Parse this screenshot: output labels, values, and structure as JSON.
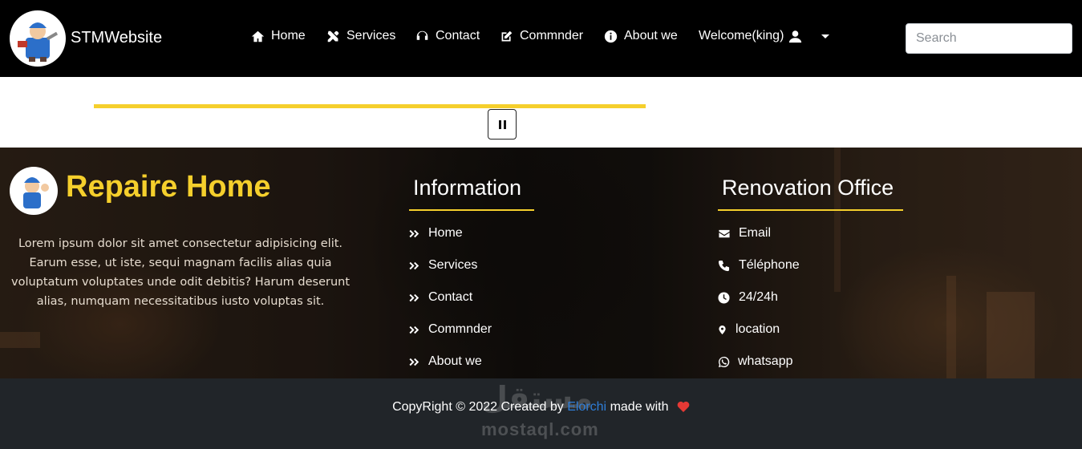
{
  "navbar": {
    "brand": "STMWebsite",
    "items": [
      {
        "label": "Home",
        "icon": "home-icon"
      },
      {
        "label": "Services",
        "icon": "tools-icon"
      },
      {
        "label": "Contact",
        "icon": "headset-icon"
      },
      {
        "label": "Commnder",
        "icon": "edit-icon"
      },
      {
        "label": "About we",
        "icon": "info-icon"
      }
    ],
    "user_menu": {
      "label": "Welcome(king)",
      "icon": "user-icon"
    },
    "search": {
      "placeholder": "Search",
      "value": ""
    }
  },
  "slider": {
    "progress_fraction": 0.512,
    "control": "pause-icon",
    "accent_color": "#f5cf2c"
  },
  "footer": {
    "brand": "Repaire Home",
    "description": "Lorem ipsum dolor sit amet consectetur adipisicing elit. Earum esse, ut iste, sequi magnam facilis alias quia voluptatum voluptates unde odit debitis? Harum deserunt alias, numquam necessitatibus iusto voluptas sit.",
    "information": {
      "title": "Information",
      "links": [
        "Home",
        "Services",
        "Contact",
        "Commnder",
        "About we"
      ]
    },
    "office": {
      "title": "Renovation Office",
      "items": [
        {
          "label": "Email",
          "icon": "envelope-icon"
        },
        {
          "label": "Téléphone",
          "icon": "phone-icon"
        },
        {
          "label": "24/24h",
          "icon": "clock-icon"
        },
        {
          "label": "location",
          "icon": "map-marker-icon"
        },
        {
          "label": "whatsapp",
          "icon": "whatsapp-icon"
        }
      ]
    }
  },
  "copyright": {
    "prefix": "CopyRight © 2022 Created by",
    "author": "Elorchi",
    "suffix": "made with",
    "heart_color": "#e53935"
  },
  "watermark": {
    "arabic": "مستقل",
    "latin": "mostaql.com"
  }
}
